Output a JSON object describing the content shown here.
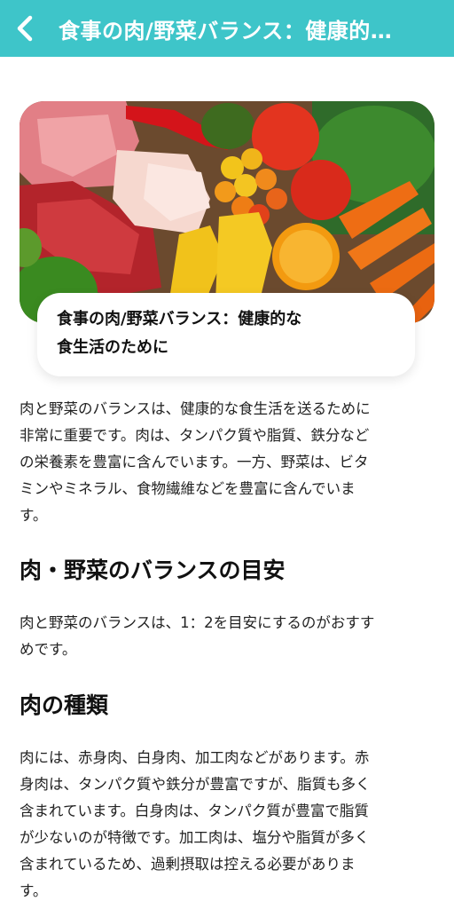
{
  "header": {
    "title": "食事の肉/野菜バランス：健康的…",
    "back_icon": "chevron-left-icon",
    "background": "#3ec5c9"
  },
  "hero": {
    "image_icon": "meat-and-vegetables-photo",
    "card_title_line1": "食事の肉/野菜バランス：健康的な",
    "card_title_line2": "食生活のために"
  },
  "article": {
    "intro_lines": [
      "肉と野菜のバランスは、健康的な食生活を送るために",
      "非常に重要です。肉は、タンパク質や脂質、鉄分など",
      "の栄養素を豊富に含んでいます。一方、野菜は、ビタ",
      "ミンやミネラル、食物繊維などを豊富に含んでいま",
      "す。"
    ],
    "section1_heading": "肉・野菜のバランスの目安",
    "section1_lines": [
      "肉と野菜のバランスは、1：2を目安にするのがおすす",
      "めです。"
    ],
    "section2_heading": "肉の種類",
    "section2_lines": [
      "肉には、赤身肉、白身肉、加工肉などがあります。赤",
      "身肉は、タンパク質や鉄分が豊富ですが、脂質も多く",
      "含まれています。白身肉は、タンパク質が豊富で脂質",
      "が少ないのが特徴です。加工肉は、塩分や脂質が多く",
      "含まれているため、過剰摂取は控える必要がありま",
      "す。"
    ]
  }
}
